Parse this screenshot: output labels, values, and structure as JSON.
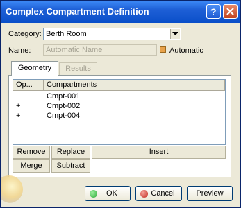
{
  "window": {
    "title": "Complex Compartment Definition"
  },
  "form": {
    "category_label": "Category:",
    "category_value": "Berth Room",
    "name_label": "Name:",
    "name_placeholder": "Automatic Name",
    "automatic_label": "Automatic"
  },
  "tabs": [
    {
      "label": "Geometry",
      "active": true
    },
    {
      "label": "Results",
      "active": false
    }
  ],
  "list": {
    "columns": [
      "Op...",
      "Compartments"
    ],
    "rows": [
      {
        "op": "",
        "name": "Cmpt-001"
      },
      {
        "op": "+",
        "name": "Cmpt-002"
      },
      {
        "op": "+",
        "name": "Cmpt-004"
      }
    ]
  },
  "actions": {
    "remove": "Remove",
    "replace": "Replace",
    "insert": "Insert",
    "merge": "Merge",
    "subtract": "Subtract"
  },
  "footer": {
    "ok": "OK",
    "cancel": "Cancel",
    "preview": "Preview"
  },
  "colors": {
    "title_bar": "#0a4fc9",
    "ok_dot": "#2aa836",
    "cancel_dot": "#c0261b",
    "automatic_check": "#e8a24a"
  },
  "icons": {
    "help": "help-icon",
    "close": "close-icon",
    "dropdown": "chevron-down-icon"
  }
}
